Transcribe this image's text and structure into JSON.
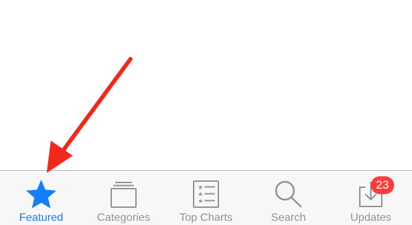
{
  "colors": {
    "accent": "#147efb",
    "inactive": "#929292",
    "badge": "#fc3d39",
    "arrow": "#f4271b",
    "tab_bar_background": "#f7f7f7"
  },
  "tab_bar": {
    "active_tab": "Featured",
    "tabs": [
      {
        "label": "Featured",
        "icon": "star-icon",
        "active": true
      },
      {
        "label": "Categories",
        "icon": "stacked-squares-icon",
        "active": false
      },
      {
        "label": "Top Charts",
        "icon": "ranked-list-icon",
        "active": false
      },
      {
        "label": "Search",
        "icon": "magnifier-icon",
        "active": false
      },
      {
        "label": "Updates",
        "icon": "download-tray-icon",
        "active": false,
        "badge": "23"
      }
    ]
  },
  "annotation": {
    "type": "arrow",
    "color": "#f4271b",
    "points_to": "Featured"
  }
}
